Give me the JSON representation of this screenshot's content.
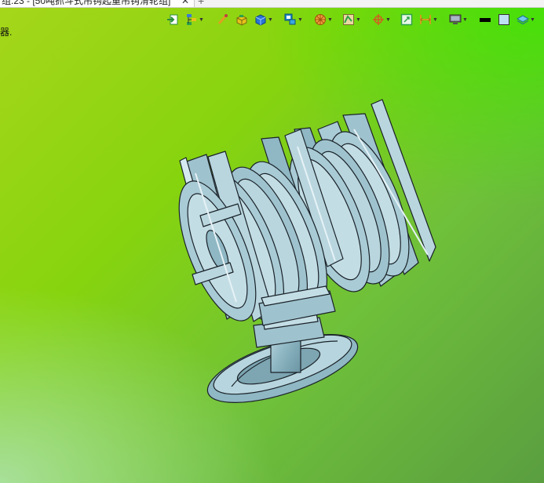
{
  "window": {
    "tab_title": "组.23 - [50吨抓斗式吊钩起重吊钩滑轮组]",
    "tab_close": "✕",
    "tab_add": "+"
  },
  "side_label": "器.",
  "toolbar": {
    "items": [
      {
        "name": "exit-app-icon",
        "color": "#2a8f3c",
        "dropdown": false
      },
      {
        "name": "assembly-tree-icon",
        "color": "#3a7bd5",
        "dropdown": true
      },
      {
        "name": "brush-icon",
        "color": "#e0a020",
        "dropdown": false
      },
      {
        "name": "yellow-block-icon",
        "color": "#e8c21a",
        "dropdown": false
      },
      {
        "name": "blue-cube-icon",
        "color": "#2a74d8",
        "dropdown": true
      },
      {
        "name": "view-cube-icon",
        "color": "#1e88c8",
        "dropdown": true
      },
      {
        "name": "section-wheel-icon",
        "color": "#e08a20",
        "dropdown": true
      },
      {
        "name": "render-style-icon",
        "color": "#c9a24a",
        "dropdown": true
      },
      {
        "name": "snap-target-icon",
        "color": "#d06020",
        "dropdown": true
      },
      {
        "name": "frame-select-icon",
        "color": "#2fa24a",
        "dropdown": false
      },
      {
        "name": "measure-icon",
        "color": "#d0a020",
        "dropdown": true
      },
      {
        "name": "monitor-icon",
        "color": "#666666",
        "dropdown": true
      },
      {
        "name": "black-swatch-icon",
        "color": "#000000",
        "dropdown": false
      },
      {
        "name": "blue-swatch-icon",
        "color": "#bde0f2",
        "dropdown": false
      },
      {
        "name": "layers-icon",
        "color": "#2aa0c8",
        "dropdown": true
      }
    ]
  },
  "viewport": {
    "background_top_right": "#3fe000",
    "background_top_left": "#a6d61a",
    "background_bottom_left": "#a8dca0",
    "background_bottom_right": "#5a9e40",
    "model_color": "#9ec4d0",
    "model_edge_color": "#1a2228"
  }
}
